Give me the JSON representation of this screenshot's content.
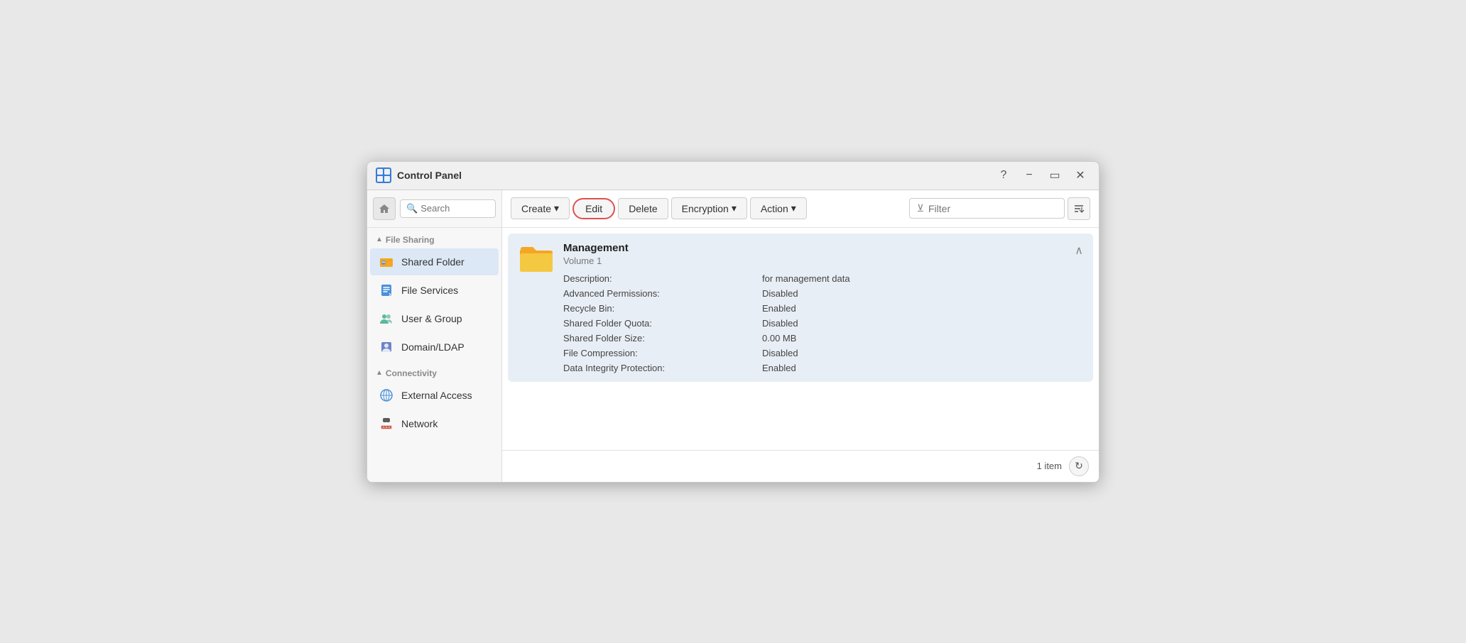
{
  "window": {
    "title": "Control Panel",
    "icon_label": "control-panel-icon"
  },
  "sidebar": {
    "search_placeholder": "Search",
    "home_icon": "🏠",
    "sections": [
      {
        "name": "file-sharing-section",
        "label": "File Sharing",
        "collapsed": false,
        "items": [
          {
            "id": "shared-folder",
            "label": "Shared Folder",
            "icon": "folder",
            "active": true
          },
          {
            "id": "file-services",
            "label": "File Services",
            "icon": "file-services"
          },
          {
            "id": "user-group",
            "label": "User & Group",
            "icon": "user-group"
          },
          {
            "id": "domain-ldap",
            "label": "Domain/LDAP",
            "icon": "domain"
          }
        ]
      },
      {
        "name": "connectivity-section",
        "label": "Connectivity",
        "collapsed": false,
        "items": [
          {
            "id": "external-access",
            "label": "External Access",
            "icon": "external"
          },
          {
            "id": "network",
            "label": "Network",
            "icon": "network"
          }
        ]
      }
    ]
  },
  "toolbar": {
    "create_label": "Create",
    "edit_label": "Edit",
    "delete_label": "Delete",
    "encryption_label": "Encryption",
    "action_label": "Action",
    "filter_placeholder": "Filter",
    "dropdown_arrow": "▾"
  },
  "folder": {
    "name": "Management",
    "volume": "Volume 1",
    "icon": "📁",
    "properties": [
      {
        "label": "Description:",
        "value": "for management data"
      },
      {
        "label": "Advanced Permissions:",
        "value": "Disabled"
      },
      {
        "label": "Recycle Bin:",
        "value": "Enabled"
      },
      {
        "label": "Shared Folder Quota:",
        "value": "Disabled"
      },
      {
        "label": "Shared Folder Size:",
        "value": "0.00 MB"
      },
      {
        "label": "File Compression:",
        "value": "Disabled"
      },
      {
        "label": "Data Integrity Protection:",
        "value": "Enabled"
      }
    ]
  },
  "statusbar": {
    "item_count": "1 item"
  }
}
